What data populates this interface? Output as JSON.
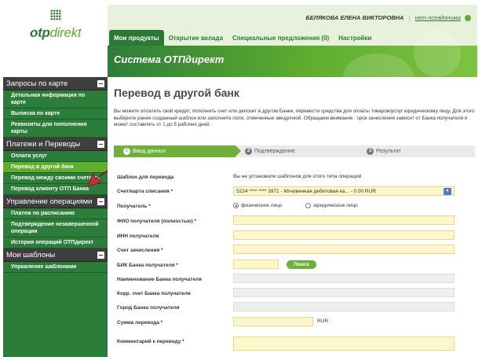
{
  "logo": {
    "text_bold": "otp",
    "text_light": "direkt"
  },
  "header": {
    "user_name": "БЕЛЯКОВА ЕЛЕНА ВИКТОРОВНА",
    "separator": "|",
    "pseudonym_link": "нет псевдонима",
    "tabs": [
      {
        "label": "Мои продукты",
        "active": true
      },
      {
        "label": "Открытие вклада",
        "active": false
      },
      {
        "label": "Специальные предложения (0)",
        "active": false
      },
      {
        "label": "Настройки",
        "active": false
      }
    ]
  },
  "banner": {
    "title": "Система ОТПдирект"
  },
  "sidebar": {
    "groups": [
      {
        "title": "Запросы по карте",
        "items": [
          {
            "label": "Детальная информация по карте",
            "selected": false
          },
          {
            "label": "Выписка по карте",
            "selected": false
          },
          {
            "label": "Реквизиты для пополнения карты",
            "selected": false
          }
        ]
      },
      {
        "title": "Платежи и Переводы",
        "items": [
          {
            "label": "Оплата услуг",
            "selected": false
          },
          {
            "label": "Перевод в другой банк",
            "selected": true
          },
          {
            "label": "Перевод между своими счетами",
            "selected": false
          },
          {
            "label": "Перевод клиенту ОТП Банка",
            "selected": false
          }
        ]
      },
      {
        "title": "Управление операциями",
        "items": [
          {
            "label": "Платеж по расписанию",
            "selected": false
          },
          {
            "label": "Подтверждение незавершенной операции",
            "selected": false
          },
          {
            "label": "История операций ОТПдирект",
            "selected": false
          }
        ]
      },
      {
        "title": "Мои шаблоны",
        "items": [
          {
            "label": "Управление шаблонами",
            "selected": false
          }
        ]
      }
    ]
  },
  "main": {
    "title": "Перевод в другой банк",
    "description": "Вы можете оплатить свой кредит, пополнить счет или депозит в другом Банке, перевести средства для оплаты товаров/услуг юридическому лицу. Для этого выберите ранее созданный шаблон или заполните поля, отмеченные звездочкой. Обращаем внимание : срок зачисления зависит от Банка получателя и может составлять от 1 до 5 рабочих дней.",
    "steps": [
      {
        "num": "1",
        "label": "Ввод данных"
      },
      {
        "num": "2",
        "label": "Подтверждение"
      },
      {
        "num": "3",
        "label": "Результат"
      }
    ],
    "form": {
      "template_label": "Шаблон для перевода",
      "template_value": "Вы не установили шаблонов для этого типа операций",
      "account_label": "Счет/карта списания *",
      "account_value": "5224 **** **** 3971 - Мгновенная дебетовая ка... - 0.00 RUR",
      "recipient_label": "Получатель *",
      "recipient_options": [
        "физическое лицо",
        "юридическое лицо"
      ],
      "fio_label": "ФИО получателя (полностью) *",
      "inn_label": "ИНН получателя",
      "account_to_label": "Счет зачисления *",
      "bik_label": "БИК Банка получателя *",
      "search_label": "Поиск",
      "bank_name_label": "Наименование Банка получателя",
      "corr_label": "Корр. счет Банка получателя",
      "city_label": "Город Банка получателя",
      "amount_label": "Сумма перевода *",
      "currency": "RUR",
      "comment_label": "Комментарий к переводу *"
    }
  },
  "colors": {
    "brand_dark": "#2d7d3a",
    "brand_light": "#5fae2e",
    "field_bg": "#fff6cc",
    "arrow": "#b8333a"
  }
}
